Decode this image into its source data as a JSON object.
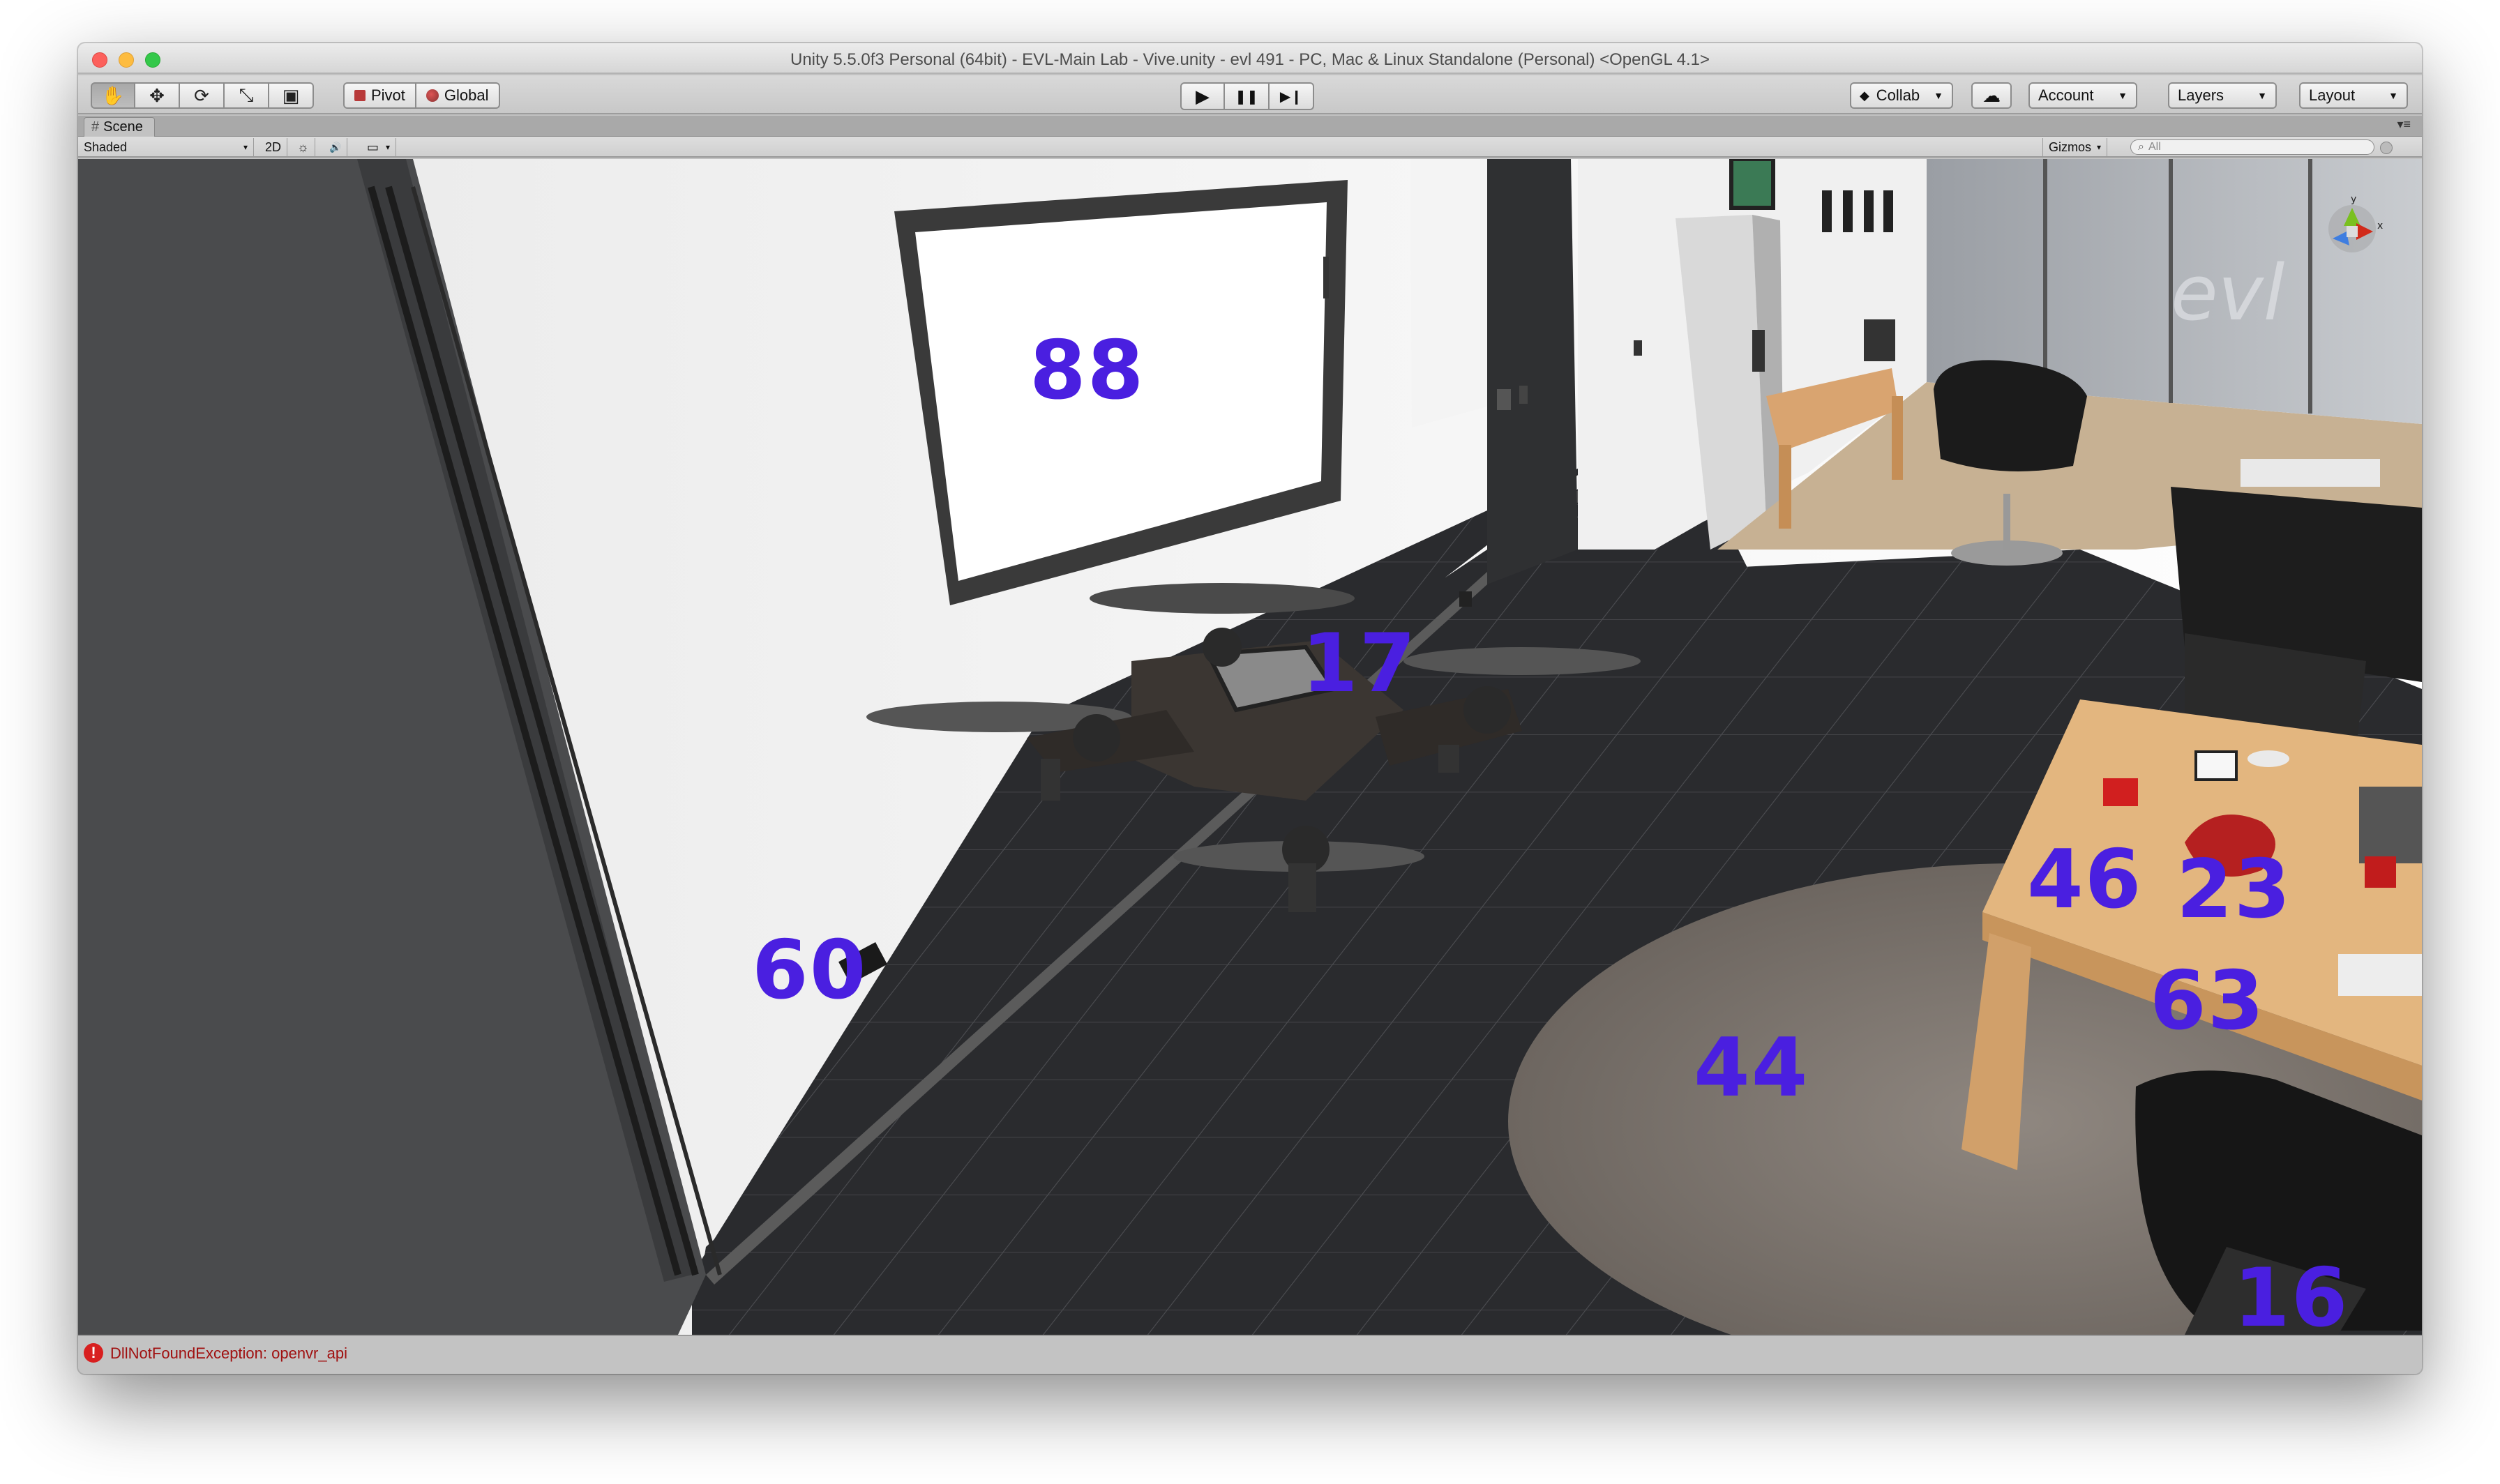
{
  "window": {
    "title": "Unity 5.5.0f3 Personal (64bit) - EVL-Main Lab - Vive.unity - evl 491 - PC, Mac & Linux Standalone (Personal) <OpenGL 4.1>"
  },
  "toolbar": {
    "transform_tools": [
      {
        "name": "hand-tool",
        "icon": "hand-icon",
        "glyph": "✋"
      },
      {
        "name": "move-tool",
        "icon": "move-icon",
        "glyph": "✥"
      },
      {
        "name": "rotate-tool",
        "icon": "rotate-icon",
        "glyph": "⟳"
      },
      {
        "name": "scale-tool",
        "icon": "scale-icon",
        "glyph": "⤡"
      },
      {
        "name": "rect-tool",
        "icon": "rect-icon",
        "glyph": "▣"
      }
    ],
    "pivot_label": "Pivot",
    "global_label": "Global",
    "play_glyph": "▶",
    "pause_glyph": "❚❚",
    "step_glyph": "▶❙",
    "collab_label": "Collab",
    "cloud_glyph": "☁",
    "account_label": "Account",
    "layers_label": "Layers",
    "layout_label": "Layout"
  },
  "scene_tab": {
    "label": "Scene",
    "icon_glyph": "#",
    "menu_glyph": "▾≡"
  },
  "scene_toolbar": {
    "shading_mode": "Shaded",
    "mode_2d": "2D",
    "light_glyph": "☼",
    "audio_glyph": "🔊",
    "fx_glyph": "▭",
    "gizmos_label": "Gizmos",
    "search_placeholder": "All"
  },
  "markers": [
    {
      "id": "88",
      "label": "88"
    },
    {
      "id": "17",
      "label": "17"
    },
    {
      "id": "60",
      "label": "60"
    },
    {
      "id": "46",
      "label": "46"
    },
    {
      "id": "23",
      "label": "23"
    },
    {
      "id": "63",
      "label": "63"
    },
    {
      "id": "44",
      "label": "44"
    },
    {
      "id": "16",
      "label": "16"
    }
  ],
  "status": {
    "error_glyph": "!",
    "message": "DllNotFoundException: openvr_api"
  },
  "colors": {
    "marker": "#4a1fe0",
    "error": "#d81f1f"
  }
}
